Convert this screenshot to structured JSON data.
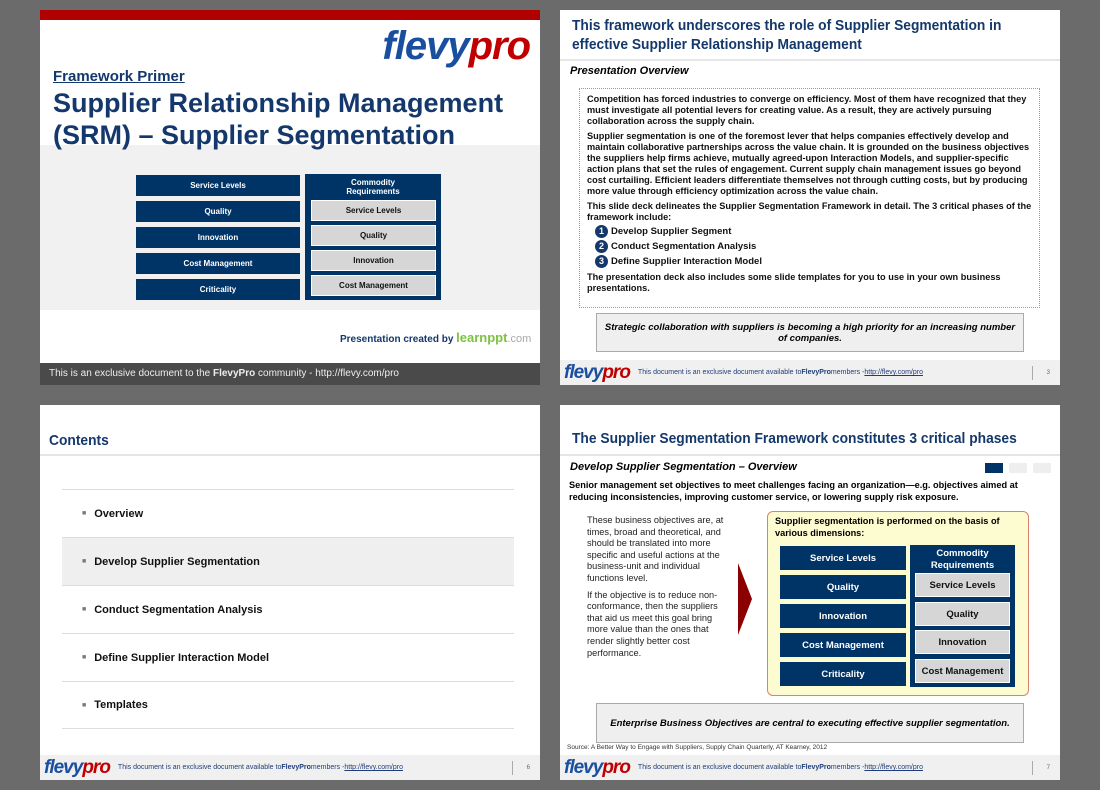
{
  "slide1": {
    "brand": {
      "logo_a": "flevy",
      "logo_b": "pro"
    },
    "kicker": "Framework Primer",
    "title_line1": "Supplier Relationship Management",
    "title_line2": "(SRM) – Supplier Segmentation",
    "left_boxes": [
      "Service Levels",
      "Quality",
      "Innovation",
      "Cost Management",
      "Criticality"
    ],
    "right_header": "Commodity Requirements",
    "right_boxes": [
      "Service Levels",
      "Quality",
      "Innovation",
      "Cost Management"
    ],
    "created_by": "Presentation created by",
    "learnppt_a": "learnppt",
    "learnppt_b": ".com",
    "footer_a": "This is an exclusive document to the ",
    "footer_b": "FlevyPro",
    "footer_c": " community - http://flevy.com/pro"
  },
  "slide2": {
    "title": "This framework underscores the role of Supplier Segmentation in effective Supplier Relationship Management",
    "subtitle": "Presentation Overview",
    "paragraphs": [
      "Competition has forced industries to converge on efficiency.  Most of them have recognized that they must investigate all potential levers for creating value.  As a result, they are actively pursuing collaboration across the supply chain.",
      "Supplier segmentation is one of the foremost lever that helps companies effectively develop and maintain collaborative partnerships across the value chain.  It is grounded on the business objectives the suppliers help firms achieve, mutually agreed-upon Interaction Models, and supplier-specific action plans that set the rules of engagement.  Current supply chain management issues go beyond cost curtailing.  Efficient leaders differentiate themselves not through cutting costs, but by producing more value through efficiency optimization across the value chain.",
      "This slide deck delineates the Supplier Segmentation Framework in detail.  The 3 critical phases of the framework include:"
    ],
    "phases": [
      {
        "n": "1",
        "label": "Develop Supplier Segment"
      },
      {
        "n": "2",
        "label": "Conduct Segmentation Analysis"
      },
      {
        "n": "3",
        "label": "Define Supplier Interaction Model"
      }
    ],
    "closing": "The presentation deck also includes some slide templates for you to use in your own business presentations.",
    "callout": "Strategic collaboration with suppliers is becoming a high priority for an increasing number of companies.",
    "page": "3"
  },
  "slide3": {
    "title": "Contents",
    "items": [
      "Overview",
      "Develop Supplier Segmentation",
      "Conduct Segmentation Analysis",
      "Define Supplier Interaction Model",
      "Templates"
    ],
    "page": "6"
  },
  "slide4": {
    "title": "The Supplier Segmentation Framework constitutes 3 critical phases",
    "subtitle": "Develop Supplier Segmentation – Overview",
    "intro": "Senior management set objectives to meet challenges facing an organization—e.g. objectives aimed at reducing inconsistencies, improving customer service, or lowering supply risk exposure.",
    "left_p1": "These business objectives are, at times, broad and theoretical, and should be translated into more specific and useful actions at the business-unit and individual functions level.",
    "left_p2": "If the objective is to reduce non-conformance, then the suppliers that aid us meet this goal bring more value than the ones that render slightly better cost performance.",
    "box_title": "Supplier segmentation is performed on the basis of various dimensions:",
    "left_boxes": [
      "Service Levels",
      "Quality",
      "Innovation",
      "Cost Management",
      "Criticality"
    ],
    "right_header": "Commodity Requirements",
    "right_boxes": [
      "Service Levels",
      "Quality",
      "Innovation",
      "Cost Management"
    ],
    "callout": "Enterprise Business Objectives are central to executing effective supplier segmentation.",
    "source": "Source: A Better Way to Engage with Suppliers, Supply Chain Quarterly, AT Kearney, 2012",
    "page": "7",
    "progress_step": 1,
    "progress_total": 3
  },
  "footer": {
    "text_a": "This document is an exclusive document available to ",
    "text_b": "FlevyPro",
    "text_c": " members - ",
    "link": "http://flevy.com/pro"
  },
  "colors": {
    "navy": "#003366",
    "title": "#14386b",
    "red": "#b00000",
    "gray_box": "#d6d6d6",
    "yellow": "#fdfbd0",
    "arrow": "#8b0000"
  }
}
